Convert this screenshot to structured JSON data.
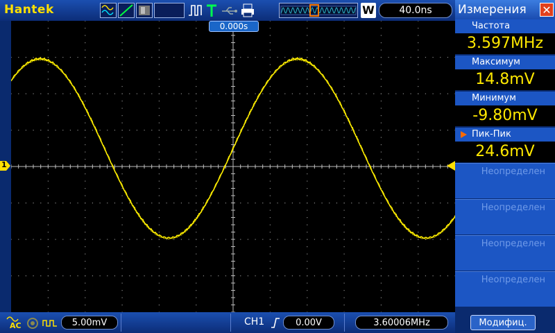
{
  "topbar": {
    "brand": "Hantek",
    "mode_letter": "W",
    "timebase": "40.0ns"
  },
  "graph": {
    "trigger_position": "0.000s",
    "channel_marker": "1"
  },
  "measurements": {
    "title": "Измерения",
    "close_icon": "close-icon",
    "items": [
      {
        "label": "Частота",
        "value": "3.597MHz",
        "selected": false
      },
      {
        "label": "Максимум",
        "value": "14.8mV",
        "selected": false
      },
      {
        "label": "Минимум",
        "value": "-9.80mV",
        "selected": false
      },
      {
        "label": "Пик-Пик",
        "value": "24.6mV",
        "selected": true
      }
    ],
    "undefined_slots": [
      "Неопределен",
      "Неопределен",
      "Неопределен",
      "Неопределен"
    ],
    "modify_label": "Модифиц."
  },
  "bottombar": {
    "coupling": "AC",
    "volts_div": "5.00mV",
    "trigger_channel": "CH1",
    "trigger_level": "0.00V",
    "trigger_frequency": "3.60006MHz"
  },
  "trace": {
    "color": "#ffee00",
    "amplitude_mV": 12.3,
    "offset_mV": 2.5,
    "volts_per_div_mV": 5.0,
    "frequency_MHz": 3.597,
    "time_per_div_ns": 40.0
  },
  "colors": {
    "accent": "#1c56c4",
    "value": "#ffe800",
    "trace": "#ffee00"
  }
}
